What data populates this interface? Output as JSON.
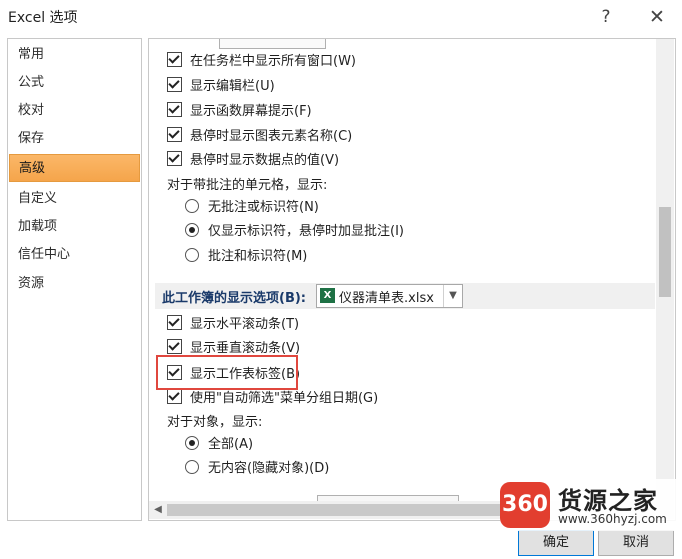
{
  "window": {
    "title": "Excel 选项",
    "help": "?",
    "close": "✕"
  },
  "sidebar": {
    "items": [
      {
        "label": "常用"
      },
      {
        "label": "公式"
      },
      {
        "label": "校对"
      },
      {
        "label": "保存"
      },
      {
        "label": "高级",
        "active": true
      },
      {
        "label": "自定义"
      },
      {
        "label": "加载项"
      },
      {
        "label": "信任中心"
      },
      {
        "label": "资源"
      }
    ]
  },
  "options": {
    "taskbar_all_windows": "在任务栏中显示所有窗口(W)",
    "show_formula_bar": "显示编辑栏(U)",
    "show_function_tips": "显示函数屏幕提示(F)",
    "hover_chart_element": "悬停时显示图表元素名称(C)",
    "hover_data_point": "悬停时显示数据点的值(V)",
    "comment_label": "对于带批注的单元格，显示:",
    "comment_none": "无批注或标识符(N)",
    "comment_indicator": "仅显示标识符，悬停时加显批注(I)",
    "comment_both": "批注和标识符(M)"
  },
  "workbook_section": {
    "title": "此工作簿的显示选项(B):",
    "workbook_name": "仪器清单表.xlsx",
    "show_hscroll": "显示水平滚动条(T)",
    "show_vscroll": "显示垂直滚动条(V)",
    "show_sheet_tabs": "显示工作表标签(B)",
    "group_dates": "使用\"自动筛选\"菜单分组日期(G)",
    "objects_label": "对于对象，显示:",
    "objects_all": "全部(A)",
    "objects_none": "无内容(隐藏对象)(D)"
  },
  "footer": {
    "ok": "确定",
    "cancel": "取消"
  },
  "watermark": {
    "logo": "360",
    "name": "货源之家",
    "url": "www.360hyzj.com"
  }
}
